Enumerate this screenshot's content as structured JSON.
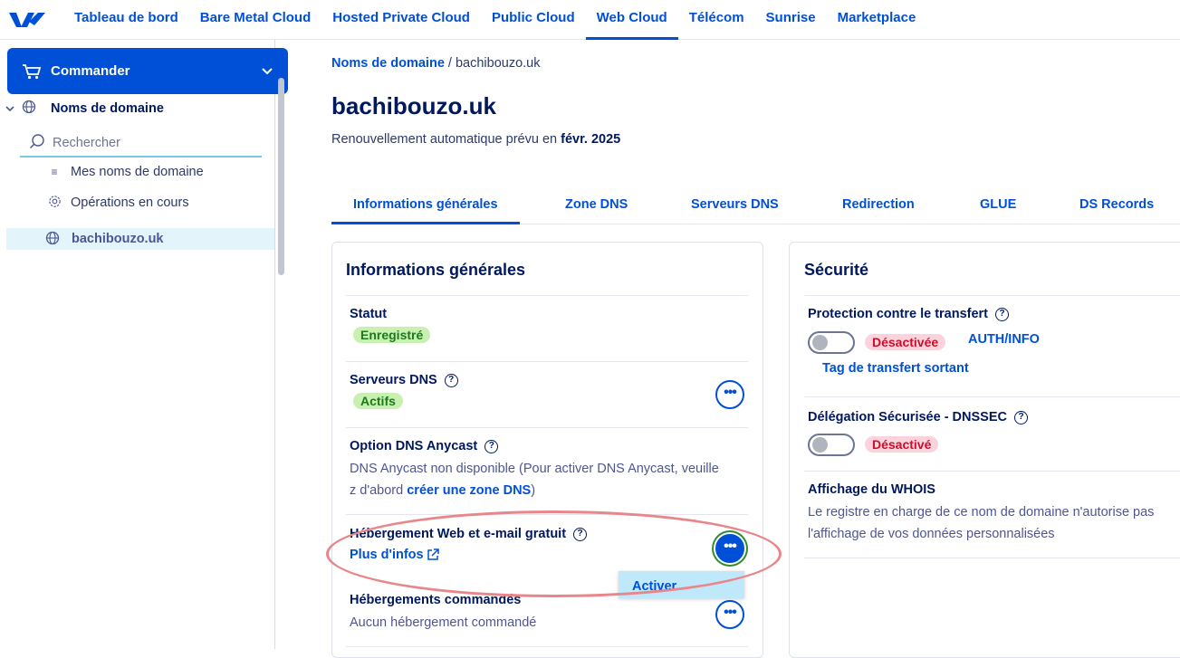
{
  "topnav": {
    "items": [
      "Tableau de bord",
      "Bare Metal Cloud",
      "Hosted Private Cloud",
      "Public Cloud",
      "Web Cloud",
      "Télécom",
      "Sunrise",
      "Marketplace"
    ],
    "active": "Web Cloud"
  },
  "sidebar": {
    "commander_label": "Commander",
    "section_label": "Noms de domaine",
    "search_placeholder": "Rechercher",
    "links": [
      "Mes noms de domaine",
      "Opérations en cours"
    ],
    "active_item": "bachibouzo.uk"
  },
  "breadcrumb": {
    "parent": "Noms de domaine",
    "separator": "/",
    "current": "bachibouzo.uk"
  },
  "page": {
    "title": "bachibouzo.uk",
    "renew_text": "Renouvellement automatique prévu en ",
    "renew_date": "févr. 2025"
  },
  "tabs": [
    "Informations générales",
    "Zone DNS",
    "Serveurs DNS",
    "Redirection",
    "GLUE",
    "DS Records"
  ],
  "general": {
    "title": "Informations générales",
    "status_label": "Statut",
    "status_value": "Enregistré",
    "dns_label": "Serveurs DNS",
    "dns_value": "Actifs",
    "anycast_label": "Option DNS Anycast",
    "anycast_text_1": "DNS Anycast non disponible (Pour activer DNS Anycast, veuille",
    "anycast_text_2": "z d'abord ",
    "anycast_link": "créer une zone DNS",
    "anycast_text_3": ")",
    "hosting_label": "Hébergement Web et e-mail gratuit",
    "hosting_link": "Plus d'infos",
    "ordered_label": "Hébergements commandés",
    "ordered_text": "Aucun hébergement commandé",
    "dropdown_item": "Activer"
  },
  "security": {
    "title": "Sécurité",
    "transfer_label": "Protection contre le transfert",
    "transfer_state": "Désactivée",
    "auth_link": "AUTH/INFO",
    "transfer_tag_link": "Tag de transfert sortant",
    "dnssec_label": "Délégation Sécurisée - DNSSEC",
    "dnssec_state": "Désactivé",
    "whois_label": "Affichage du WHOIS",
    "whois_text_1": "Le registre en charge de ce nom de domaine n'autorise pas",
    "whois_text_2": "l'affichage de vos données personnalisées"
  },
  "colors": {
    "primary": "#0050d7",
    "text_dark": "#00185e",
    "active_bg": "#e4f4fb",
    "badge_green_bg": "#c8f0b0",
    "badge_red_bg": "#fcd3dc",
    "annotation": "#e8868a"
  }
}
